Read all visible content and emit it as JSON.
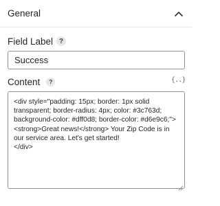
{
  "section": {
    "title": "General",
    "toggle_icon": "chevron-up-icon"
  },
  "field_label": {
    "label": "Field Label",
    "help": "?",
    "value": "Success"
  },
  "content": {
    "label": "Content",
    "help": "?",
    "merge_tag_button": "{..}",
    "value": "<div style=\"padding: 15px; border: 1px solid transparent; border-radius: 4px; color: #3c763d; background-color: #dff0d8; border-color: #d6e9c6;\">\n<strong>Great news!</strong> Your Zip Code is in our service area. Let's get started!\n</div>"
  },
  "colors": {
    "text": "#1d2327",
    "border": "#8c9096",
    "help_badge_bg": "#e6e7ea"
  }
}
